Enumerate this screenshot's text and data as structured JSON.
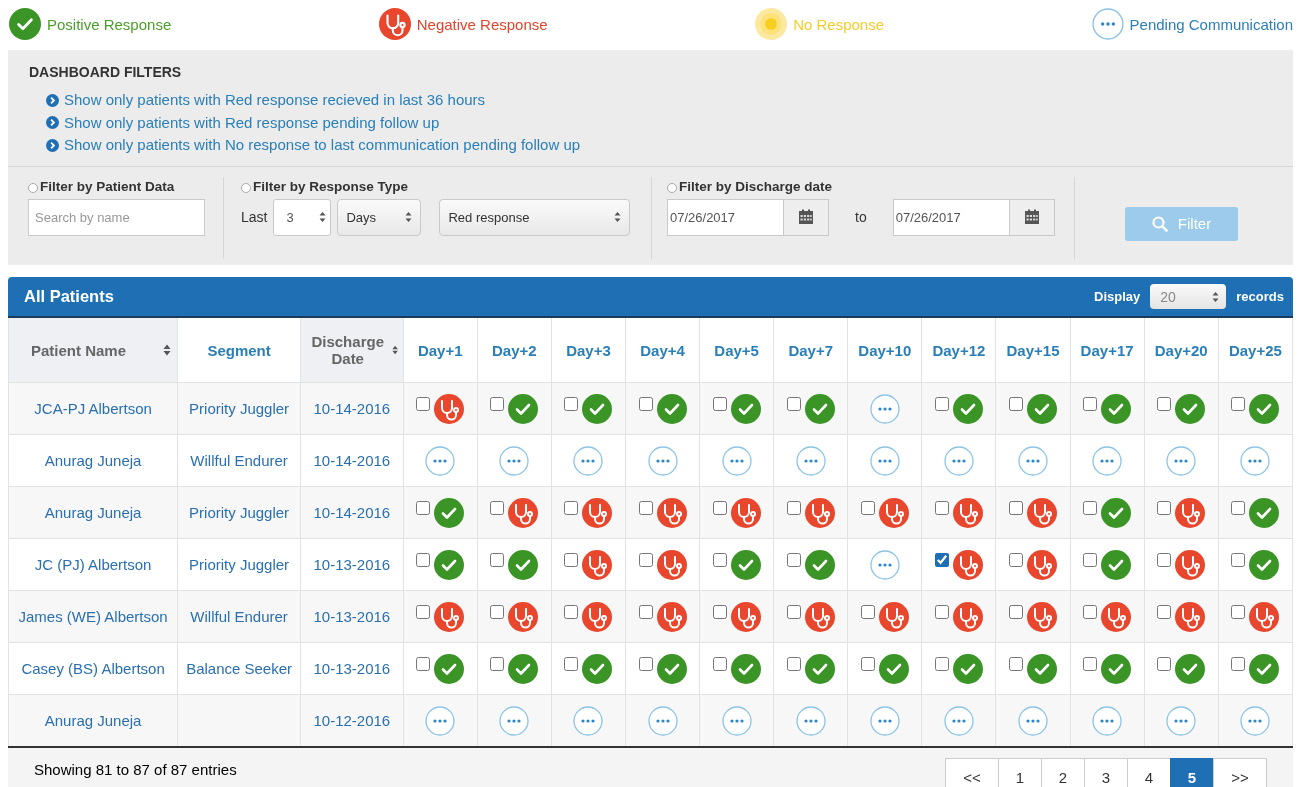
{
  "legend": [
    {
      "kind": "positive",
      "label": "Positive Response"
    },
    {
      "kind": "negative",
      "label": "Negative Response"
    },
    {
      "kind": "none",
      "label": "No Response"
    },
    {
      "kind": "pending",
      "label": "Pending Communication"
    }
  ],
  "filters": {
    "title": "DASHBOARD FILTERS",
    "quick_links": [
      "Show only patients with Red response recieved in last 36 hours",
      "Show only patients with Red response pending follow up",
      "Show only patients with No response to last communication pending follow up"
    ],
    "patient_data": {
      "label": "Filter by Patient Data",
      "selected": false,
      "search_placeholder": "Search by name"
    },
    "response_type": {
      "label": "Filter by Response Type",
      "selected": false,
      "last_label": "Last",
      "count": "3",
      "unit": "Days",
      "response": "Red response"
    },
    "discharge_date": {
      "label": "Filter by Discharge date",
      "selected": false,
      "from": "07/26/2017",
      "to_label": "to",
      "to": "07/26/2017"
    },
    "filter_button": {
      "label": "Filter",
      "disabled": true
    }
  },
  "table": {
    "title": "All Patients",
    "display_label": "Display",
    "page_size": "20",
    "records_label": "records",
    "columns": [
      {
        "label": "Patient Name",
        "sortable": true
      },
      {
        "label": "Segment",
        "sortable": false
      },
      {
        "label": "Discharge Date",
        "sortable": true
      },
      {
        "label": "Day+1",
        "sortable": false
      },
      {
        "label": "Day+2",
        "sortable": false
      },
      {
        "label": "Day+3",
        "sortable": false
      },
      {
        "label": "Day+4",
        "sortable": false
      },
      {
        "label": "Day+5",
        "sortable": false
      },
      {
        "label": "Day+7",
        "sortable": false
      },
      {
        "label": "Day+10",
        "sortable": false
      },
      {
        "label": "Day+12",
        "sortable": false
      },
      {
        "label": "Day+15",
        "sortable": false
      },
      {
        "label": "Day+17",
        "sortable": false
      },
      {
        "label": "Day+20",
        "sortable": false
      },
      {
        "label": "Day+25",
        "sortable": false
      }
    ],
    "rows": [
      {
        "patient": "JCA-PJ Albertson",
        "segment": "Priority Juggler",
        "discharge_date": "10-14-2016",
        "cells": [
          {
            "kind": "negative",
            "checked": false
          },
          {
            "kind": "positive",
            "checked": false
          },
          {
            "kind": "positive",
            "checked": false
          },
          {
            "kind": "positive",
            "checked": false
          },
          {
            "kind": "positive",
            "checked": false
          },
          {
            "kind": "positive",
            "checked": false
          },
          {
            "kind": "pending"
          },
          {
            "kind": "positive",
            "checked": false
          },
          {
            "kind": "positive",
            "checked": false
          },
          {
            "kind": "positive",
            "checked": false
          },
          {
            "kind": "positive",
            "checked": false
          },
          {
            "kind": "positive",
            "checked": false
          }
        ]
      },
      {
        "patient": "Anurag Juneja",
        "segment": "Willful Endurer",
        "discharge_date": "10-14-2016",
        "cells": [
          {
            "kind": "pending"
          },
          {
            "kind": "pending"
          },
          {
            "kind": "pending"
          },
          {
            "kind": "pending"
          },
          {
            "kind": "pending"
          },
          {
            "kind": "pending"
          },
          {
            "kind": "pending"
          },
          {
            "kind": "pending"
          },
          {
            "kind": "pending"
          },
          {
            "kind": "pending"
          },
          {
            "kind": "pending"
          },
          {
            "kind": "pending"
          }
        ]
      },
      {
        "patient": "Anurag Juneja",
        "segment": "Priority Juggler",
        "discharge_date": "10-14-2016",
        "cells": [
          {
            "kind": "positive",
            "checked": false
          },
          {
            "kind": "negative",
            "checked": false
          },
          {
            "kind": "negative",
            "checked": false
          },
          {
            "kind": "negative",
            "checked": false
          },
          {
            "kind": "negative",
            "checked": false
          },
          {
            "kind": "negative",
            "checked": false
          },
          {
            "kind": "negative",
            "checked": false
          },
          {
            "kind": "negative",
            "checked": false
          },
          {
            "kind": "negative",
            "checked": false
          },
          {
            "kind": "positive",
            "checked": false
          },
          {
            "kind": "negative",
            "checked": false
          },
          {
            "kind": "positive",
            "checked": false
          }
        ]
      },
      {
        "patient": "JC (PJ) Albertson",
        "segment": "Priority Juggler",
        "discharge_date": "10-13-2016",
        "cells": [
          {
            "kind": "positive",
            "checked": false
          },
          {
            "kind": "positive",
            "checked": false
          },
          {
            "kind": "negative",
            "checked": false
          },
          {
            "kind": "negative",
            "checked": false
          },
          {
            "kind": "positive",
            "checked": false
          },
          {
            "kind": "positive",
            "checked": false
          },
          {
            "kind": "pending"
          },
          {
            "kind": "negative",
            "checked": true
          },
          {
            "kind": "negative",
            "checked": false
          },
          {
            "kind": "positive",
            "checked": false
          },
          {
            "kind": "negative",
            "checked": false
          },
          {
            "kind": "positive",
            "checked": false
          }
        ]
      },
      {
        "patient": "James (WE) Albertson",
        "segment": "Willful Endurer",
        "discharge_date": "10-13-2016",
        "cells": [
          {
            "kind": "negative",
            "checked": false
          },
          {
            "kind": "negative",
            "checked": false
          },
          {
            "kind": "negative",
            "checked": false
          },
          {
            "kind": "negative",
            "checked": false
          },
          {
            "kind": "negative",
            "checked": false
          },
          {
            "kind": "negative",
            "checked": false
          },
          {
            "kind": "negative",
            "checked": false
          },
          {
            "kind": "negative",
            "checked": false
          },
          {
            "kind": "negative",
            "checked": false
          },
          {
            "kind": "negative",
            "checked": false
          },
          {
            "kind": "negative",
            "checked": false
          },
          {
            "kind": "negative",
            "checked": false
          }
        ]
      },
      {
        "patient": "Casey (BS) Albertson",
        "segment": "Balance Seeker",
        "discharge_date": "10-13-2016",
        "cells": [
          {
            "kind": "positive",
            "checked": false
          },
          {
            "kind": "positive",
            "checked": false
          },
          {
            "kind": "positive",
            "checked": false
          },
          {
            "kind": "positive",
            "checked": false
          },
          {
            "kind": "positive",
            "checked": false
          },
          {
            "kind": "positive",
            "checked": false
          },
          {
            "kind": "positive",
            "checked": false
          },
          {
            "kind": "positive",
            "checked": false
          },
          {
            "kind": "positive",
            "checked": false
          },
          {
            "kind": "positive",
            "checked": false
          },
          {
            "kind": "positive",
            "checked": false
          },
          {
            "kind": "positive",
            "checked": false
          }
        ]
      },
      {
        "patient": "Anurag Juneja",
        "discharge_date": "10-12-2016",
        "cells": [
          {
            "kind": "pending"
          },
          {
            "kind": "pending"
          },
          {
            "kind": "pending"
          },
          {
            "kind": "pending"
          },
          {
            "kind": "pending"
          },
          {
            "kind": "pending"
          },
          {
            "kind": "pending"
          },
          {
            "kind": "pending"
          },
          {
            "kind": "pending"
          },
          {
            "kind": "pending"
          },
          {
            "kind": "pending"
          },
          {
            "kind": "pending"
          }
        ]
      }
    ]
  },
  "footer": {
    "summary": "Showing 81 to 87 of 87 entries",
    "pagination": [
      {
        "label": "<<",
        "selected": false
      },
      {
        "label": "1",
        "selected": false
      },
      {
        "label": "2",
        "selected": false
      },
      {
        "label": "3",
        "selected": false
      },
      {
        "label": "4",
        "selected": false
      },
      {
        "label": "5",
        "selected": true
      },
      {
        "label": ">>",
        "selected": false
      }
    ]
  }
}
